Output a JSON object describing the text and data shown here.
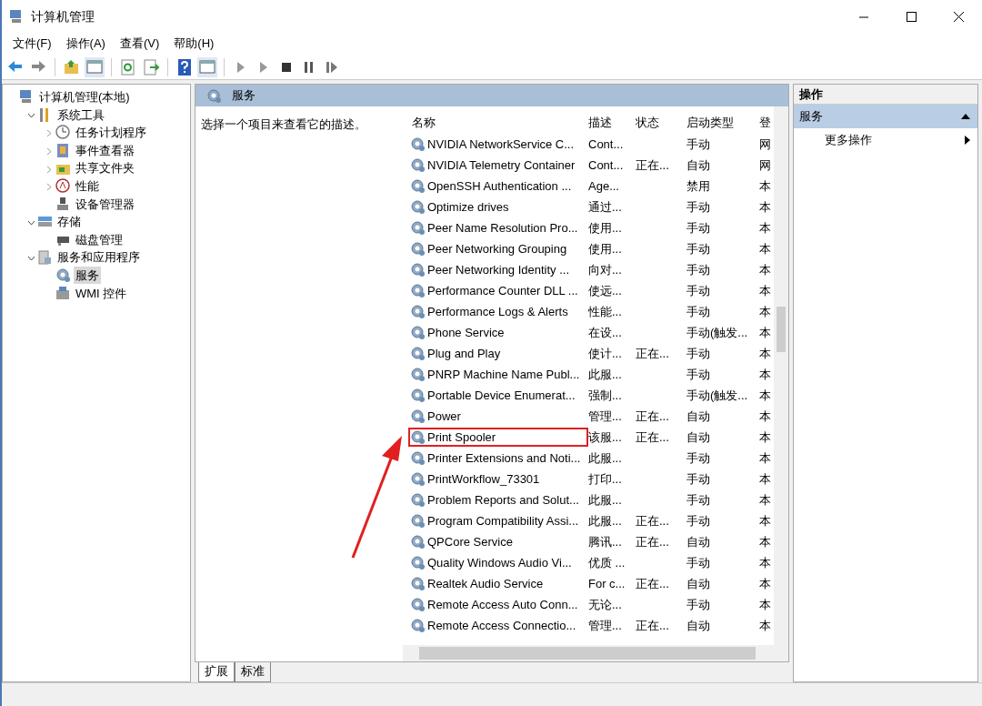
{
  "window": {
    "title": "计算机管理"
  },
  "menu": [
    "文件(F)",
    "操作(A)",
    "查看(V)",
    "帮助(H)"
  ],
  "tree": [
    {
      "label": "计算机管理(本地)",
      "kind": "leaf",
      "selected": false,
      "children": [
        {
          "label": "系统工具",
          "kind": "branch",
          "expanded": true,
          "selected": false,
          "children": [
            {
              "label": "任务计划程序",
              "kind": "branch",
              "expanded": false,
              "selected": false
            },
            {
              "label": "事件查看器",
              "kind": "branch",
              "expanded": false,
              "selected": false
            },
            {
              "label": "共享文件夹",
              "kind": "branch",
              "expanded": false,
              "selected": false
            },
            {
              "label": "性能",
              "kind": "branch",
              "expanded": false,
              "selected": false
            },
            {
              "label": "设备管理器",
              "kind": "leaf",
              "selected": false
            }
          ]
        },
        {
          "label": "存储",
          "kind": "branch",
          "expanded": true,
          "selected": false,
          "children": [
            {
              "label": "磁盘管理",
              "kind": "leaf",
              "selected": false
            }
          ]
        },
        {
          "label": "服务和应用程序",
          "kind": "branch",
          "expanded": true,
          "selected": false,
          "children": [
            {
              "label": "服务",
              "kind": "leaf",
              "selected": true
            },
            {
              "label": "WMI 控件",
              "kind": "leaf",
              "selected": false
            }
          ]
        }
      ]
    }
  ],
  "center": {
    "title": "服务",
    "description": "选择一个项目来查看它的描述。"
  },
  "table": {
    "columns": [
      "名称",
      "描述",
      "状态",
      "启动类型",
      "登"
    ],
    "rows": [
      {
        "cells": [
          "NVIDIA NetworkService C...",
          "Cont...",
          "",
          "手动",
          "网"
        ],
        "highlighted": false
      },
      {
        "cells": [
          "NVIDIA Telemetry Container",
          "Cont...",
          "正在...",
          "自动",
          "网"
        ],
        "highlighted": false
      },
      {
        "cells": [
          "OpenSSH Authentication ...",
          "Age...",
          "",
          "禁用",
          "本"
        ],
        "highlighted": false
      },
      {
        "cells": [
          "Optimize drives",
          "通过...",
          "",
          "手动",
          "本"
        ],
        "highlighted": false
      },
      {
        "cells": [
          "Peer Name Resolution Pro...",
          "使用...",
          "",
          "手动",
          "本"
        ],
        "highlighted": false
      },
      {
        "cells": [
          "Peer Networking Grouping",
          "使用...",
          "",
          "手动",
          "本"
        ],
        "highlighted": false
      },
      {
        "cells": [
          "Peer Networking Identity ...",
          "向对...",
          "",
          "手动",
          "本"
        ],
        "highlighted": false
      },
      {
        "cells": [
          "Performance Counter DLL ...",
          "使远...",
          "",
          "手动",
          "本"
        ],
        "highlighted": false
      },
      {
        "cells": [
          "Performance Logs & Alerts",
          "性能...",
          "",
          "手动",
          "本"
        ],
        "highlighted": false
      },
      {
        "cells": [
          "Phone Service",
          "在设...",
          "",
          "手动(触发...",
          "本"
        ],
        "highlighted": false
      },
      {
        "cells": [
          "Plug and Play",
          "使计...",
          "正在...",
          "手动",
          "本"
        ],
        "highlighted": false
      },
      {
        "cells": [
          "PNRP Machine Name Publ...",
          "此服...",
          "",
          "手动",
          "本"
        ],
        "highlighted": false
      },
      {
        "cells": [
          "Portable Device Enumerat...",
          "强制...",
          "",
          "手动(触发...",
          "本"
        ],
        "highlighted": false
      },
      {
        "cells": [
          "Power",
          "管理...",
          "正在...",
          "自动",
          "本"
        ],
        "highlighted": false
      },
      {
        "cells": [
          "Print Spooler",
          "该服...",
          "正在...",
          "自动",
          "本"
        ],
        "highlighted": true
      },
      {
        "cells": [
          "Printer Extensions and Noti...",
          "此服...",
          "",
          "手动",
          "本"
        ],
        "highlighted": false
      },
      {
        "cells": [
          "PrintWorkflow_73301",
          "打印...",
          "",
          "手动",
          "本"
        ],
        "highlighted": false
      },
      {
        "cells": [
          "Problem Reports and Solut...",
          "此服...",
          "",
          "手动",
          "本"
        ],
        "highlighted": false
      },
      {
        "cells": [
          "Program Compatibility Assi...",
          "此服...",
          "正在...",
          "手动",
          "本"
        ],
        "highlighted": false
      },
      {
        "cells": [
          "QPCore Service",
          "腾讯...",
          "正在...",
          "自动",
          "本"
        ],
        "highlighted": false
      },
      {
        "cells": [
          "Quality Windows Audio Vi...",
          "优质 ...",
          "",
          "手动",
          "本"
        ],
        "highlighted": false
      },
      {
        "cells": [
          "Realtek Audio Service",
          "For c...",
          "正在...",
          "自动",
          "本"
        ],
        "highlighted": false
      },
      {
        "cells": [
          "Remote Access Auto Conn...",
          "无论...",
          "",
          "手动",
          "本"
        ],
        "highlighted": false
      },
      {
        "cells": [
          "Remote Access Connectio...",
          "管理...",
          "正在...",
          "自动",
          "本"
        ],
        "highlighted": false
      }
    ]
  },
  "bottom_tabs": [
    {
      "label": "扩展",
      "selected": true
    },
    {
      "label": "标准",
      "selected": false
    }
  ],
  "actions": {
    "title": "操作",
    "section": "服务",
    "items": [
      "更多操作"
    ]
  }
}
